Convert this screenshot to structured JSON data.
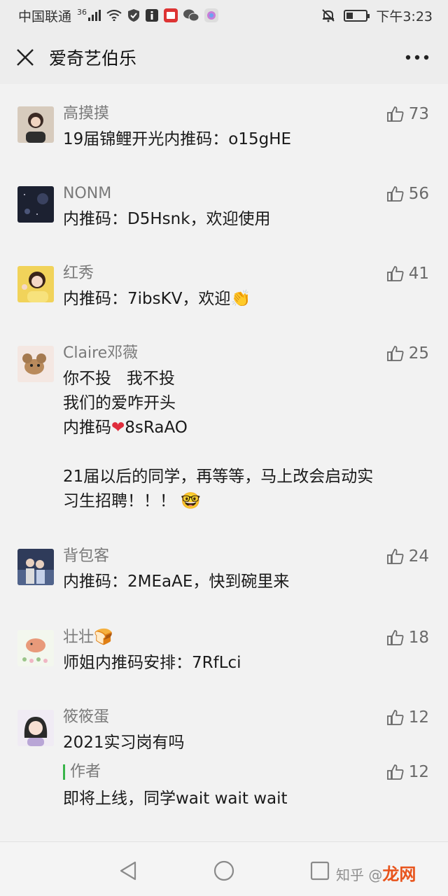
{
  "status_bar": {
    "carrier": "中国联通",
    "network": "36",
    "time": "下午3:23",
    "battery_level": 0.35
  },
  "header": {
    "title": "爱奇艺伯乐",
    "close_icon": "close-icon",
    "more_icon": "more-icon"
  },
  "comments": [
    {
      "name": "高摸摸",
      "text": "19届锦鲤开光内推码：o15gHE",
      "likes": "73",
      "avatar_color": "#c9b9a8"
    },
    {
      "name": "NONM",
      "text": "内推码：D5Hsnk，欢迎使用",
      "likes": "56",
      "avatar_color": "#23283a"
    },
    {
      "name": "红秀",
      "text": "内推码：7ibsKV，欢迎",
      "emoji": "👏",
      "likes": "41",
      "avatar_color": "#e8c94a"
    },
    {
      "name": "Claire邓薇",
      "line1": "你不投   我不投",
      "line2": "我们的爱咋开头",
      "line3a": "内推码",
      "heart": "❤",
      "line3b": "8sRaAO",
      "line4": "21届以后的同学，再等等，马上改会启动实",
      "line5": "习生招聘！！！",
      "emoji": "🤓",
      "likes": "25",
      "avatar_color": "#f3e6e2"
    },
    {
      "name": "背包客",
      "text": "内推码：2MEaAE，快到碗里来",
      "likes": "24",
      "avatar_color": "#3c4b6a"
    },
    {
      "name": "壮壮",
      "name_emoji": "🍞",
      "text": "师姐内推码安排：7RfLci",
      "likes": "18",
      "avatar_color": "#eef4e7"
    },
    {
      "name": "筱筱蛋",
      "text": "2021实习岗有吗",
      "likes": "12",
      "avatar_color": "#efe9f3",
      "reply": {
        "name": "作者",
        "text": "即将上线，同学wait wait wait",
        "likes": "12"
      }
    }
  ],
  "nav": {
    "back_icon": "back-triangle-icon",
    "home_icon": "home-circle-icon",
    "recent_icon": "recent-square-icon"
  },
  "watermark": {
    "left": "知乎 @",
    "brand": "龙网"
  },
  "colors": {
    "background": "#f2f2f2",
    "accent_green": "#39b54a",
    "name_gray": "#7a7a7a"
  }
}
